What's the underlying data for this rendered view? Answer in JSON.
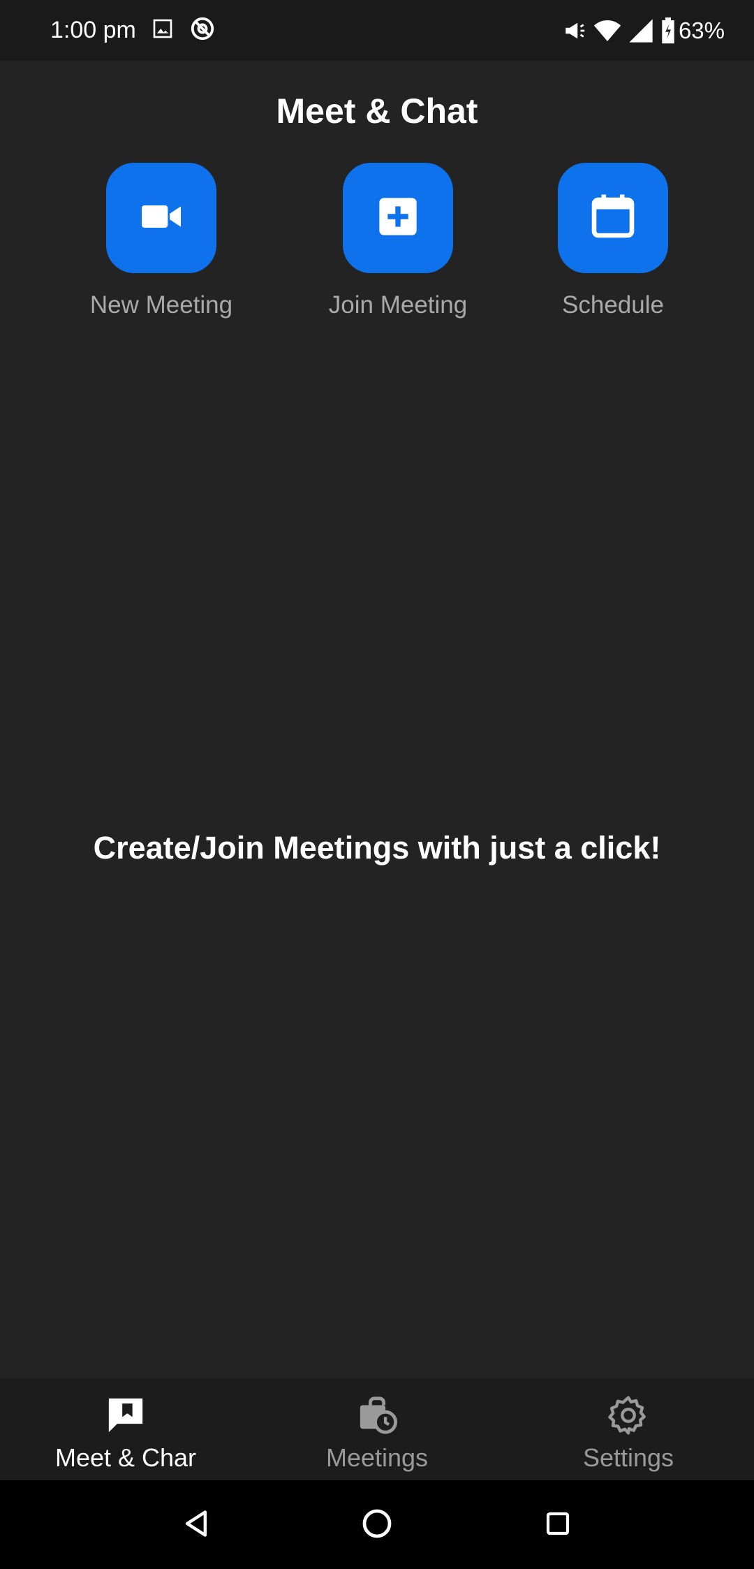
{
  "status_bar": {
    "time": "1:00 pm",
    "battery": "63%",
    "icons": [
      "image-icon",
      "at-sign-icon",
      "megaphone-icon",
      "wifi-icon",
      "signal-icon",
      "battery-charging-icon"
    ]
  },
  "header": {
    "title": "Meet & Chat"
  },
  "actions": [
    {
      "label": "New Meeting",
      "icon": "video-camera-icon"
    },
    {
      "label": "Join Meeting",
      "icon": "plus-square-icon"
    },
    {
      "label": "Schedule",
      "icon": "calendar-icon"
    }
  ],
  "main": {
    "empty_message": "Create/Join Meetings with just a click!"
  },
  "tabs": [
    {
      "label": "Meet & Char",
      "icon": "chat-bookmark-icon",
      "active": true
    },
    {
      "label": "Meetings",
      "icon": "briefcase-clock-icon",
      "active": false
    },
    {
      "label": "Settings",
      "icon": "gear-icon",
      "active": false
    }
  ],
  "nav": {
    "icons": [
      "back-icon",
      "home-icon",
      "recents-icon"
    ]
  },
  "colors": {
    "background": "#232323",
    "accent": "#0e72ed",
    "tab_bar": "#1c1c1c",
    "status_bar": "#1a1a1a"
  }
}
